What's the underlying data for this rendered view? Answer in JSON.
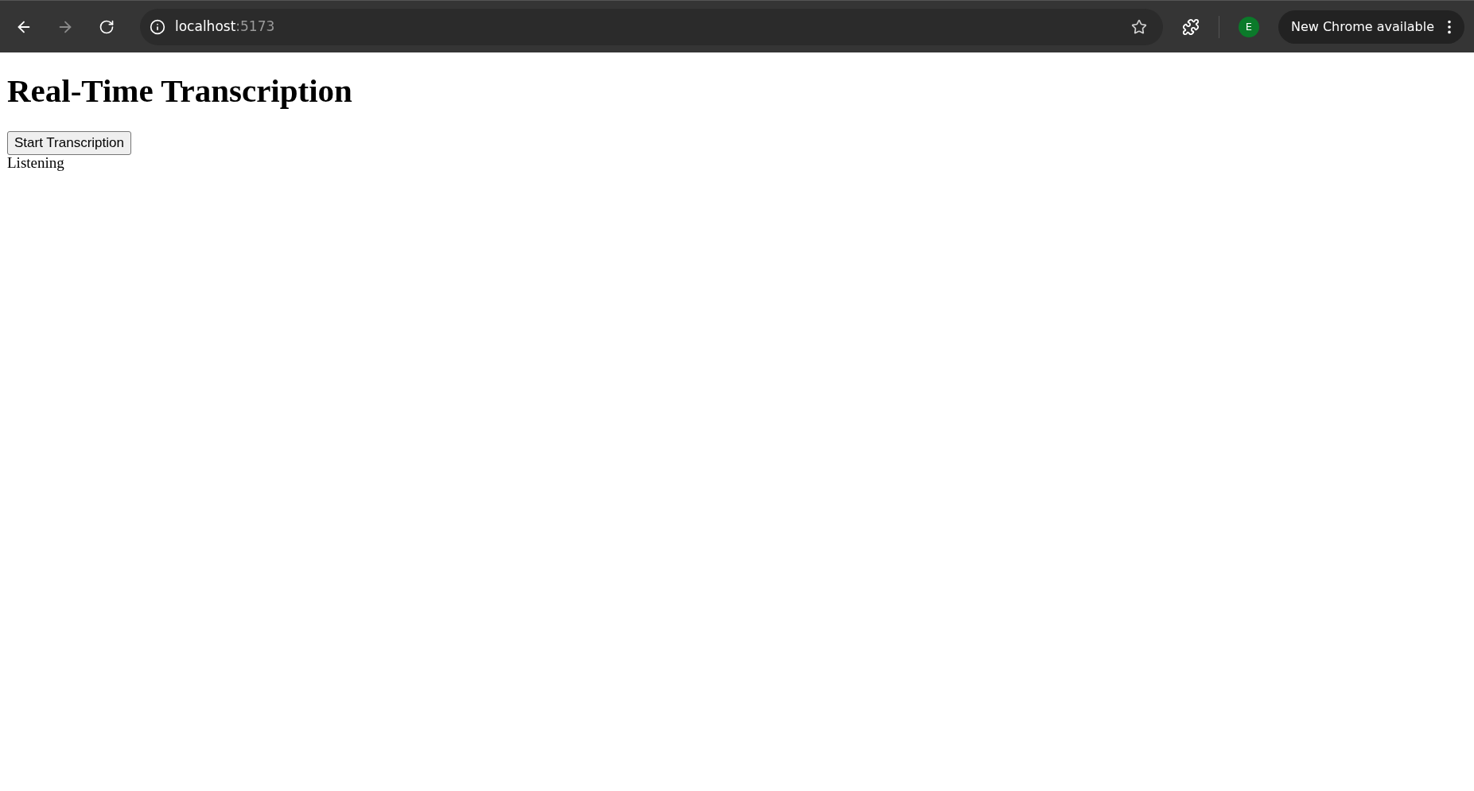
{
  "browser": {
    "address": {
      "host": "localhost",
      "port": ":5173"
    },
    "profile_initial": "E",
    "update_chip": "New Chrome available"
  },
  "page": {
    "heading": "Real-Time Transcription",
    "button": "Start Transcription",
    "status": "Listening"
  }
}
